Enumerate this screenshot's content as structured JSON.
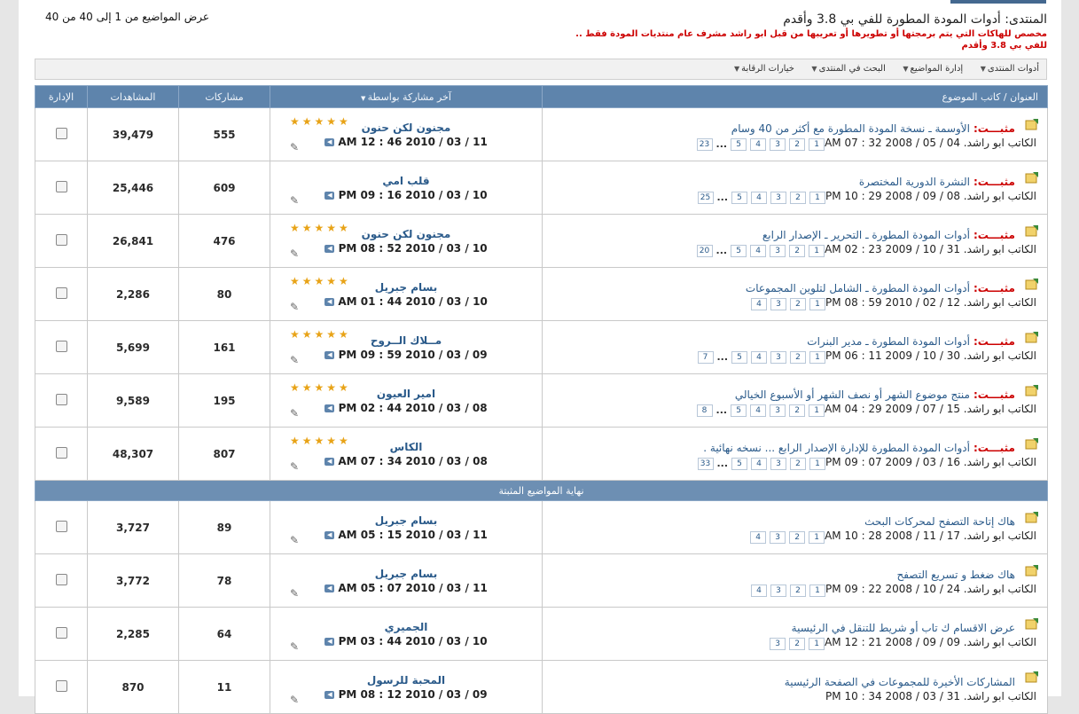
{
  "header": {
    "forum_title": "المنتدى: أدوات المودة المطورة للفي بي 3.8 وأقدم",
    "forum_desc_1": "مخصص للهاكات التي يتم برمجتها أو تطويرها أو تعريبها من قبل ابو راشد مشرف عام منتديات المودة فقط ..",
    "forum_desc_2": "للفي بي 3.8 وأقدم",
    "showing": "عرض المواضيع من 1 إلى 40 من 40"
  },
  "toolbar": {
    "items": [
      "أدوات المنتدى",
      "إدارة المواضيع",
      "البحث في المنتدى",
      "خيارات الرقابة"
    ]
  },
  "columns": {
    "title": "العنوان / كاتب الموضوع",
    "last_post": "آخر مشاركة بواسطة",
    "replies": "مشاركات",
    "views": "المشاهدات",
    "mod": "الإدارة"
  },
  "sticky_separator": "نهاية المواضيع المثبتة",
  "sticky_prefix": "مثبـــت:",
  "threads": [
    {
      "title": "الأوسمة ـ نسخة المودة المطورة مع أكثر من 40 وسام",
      "prefix": true,
      "meta": "الكاتب ابو راشد. 04 / 05 / 2008 32 : 07 AM",
      "pages": [
        "1",
        "2",
        "3",
        "4",
        "5",
        "...",
        "23"
      ],
      "stars": true,
      "last_user": "مجنون لكن حنون",
      "last_date": "11 / 03 / 2010 46 : 12 AM",
      "replies": "555",
      "views": "39,479"
    },
    {
      "title": "النشرة الدورية المختصرة",
      "prefix": true,
      "meta": "الكاتب ابو راشد. 08 / 09 / 2008 29 : 10 PM",
      "pages": [
        "1",
        "2",
        "3",
        "4",
        "5",
        "...",
        "25"
      ],
      "stars": false,
      "last_user": "قلب امي",
      "last_date": "10 / 03 / 2010 16 : 09 PM",
      "replies": "609",
      "views": "25,446"
    },
    {
      "title": "أدوات المودة المطورة ـ التحرير ـ الإصدار الرابع",
      "prefix": true,
      "meta": "الكاتب ابو راشد. 31 / 10 / 2009 23 : 02 AM",
      "pages": [
        "1",
        "2",
        "3",
        "4",
        "5",
        "...",
        "20"
      ],
      "stars": true,
      "last_user": "مجنون لكن حنون",
      "last_date": "10 / 03 / 2010 52 : 08 PM",
      "replies": "476",
      "views": "26,841"
    },
    {
      "title": "أدوات المودة المطورة ـ الشامل لتلوين المجموعات",
      "prefix": true,
      "meta": "الكاتب ابو راشد. 12 / 02 / 2010 59 : 08 PM",
      "pages": [
        "1",
        "2",
        "3",
        "4"
      ],
      "stars": true,
      "last_user": "بسام جبريل",
      "last_date": "10 / 03 / 2010 44 : 01 AM",
      "replies": "80",
      "views": "2,286"
    },
    {
      "title": "أدوات المودة المطورة ـ مدير البنرات",
      "prefix": true,
      "meta": "الكاتب ابو راشد. 30 / 10 / 2009 11 : 06 PM",
      "pages": [
        "1",
        "2",
        "3",
        "4",
        "5",
        "...",
        "7"
      ],
      "stars": true,
      "last_user": "مــلاك الــروح",
      "last_date": "09 / 03 / 2010 59 : 09 PM",
      "replies": "161",
      "views": "5,699"
    },
    {
      "title": "منتج موضوع الشهر أو نصف الشهر أو الأسبوع الخيالي",
      "prefix": true,
      "meta": "الكاتب ابو راشد. 15 / 07 / 2009 29 : 04 AM",
      "pages": [
        "1",
        "2",
        "3",
        "4",
        "5",
        "...",
        "8"
      ],
      "stars": true,
      "last_user": "امير العيون",
      "last_date": "08 / 03 / 2010 44 : 02 PM",
      "replies": "195",
      "views": "9,589"
    },
    {
      "title": "أدوات المودة المطورة للإدارة الإصدار الرابع ... نسخه نهائية .",
      "prefix": true,
      "meta": "الكاتب ابو راشد. 16 / 03 / 2009 07 : 09 PM",
      "pages": [
        "1",
        "2",
        "3",
        "4",
        "5",
        "...",
        "33"
      ],
      "stars": true,
      "last_user": "الكاس",
      "last_date": "08 / 03 / 2010 34 : 07 AM",
      "replies": "807",
      "views": "48,307"
    },
    {
      "title": "هاك إتاحة التصفح لمحركات البحث",
      "prefix": false,
      "meta": "الكاتب ابو راشد. 17 / 11 / 2008 28 : 10 AM",
      "pages": [
        "1",
        "2",
        "3",
        "4"
      ],
      "stars": false,
      "last_user": "بسام جبريل",
      "last_date": "11 / 03 / 2010 15 : 05 AM",
      "replies": "89",
      "views": "3,727"
    },
    {
      "title": "هاك ضغط و تسريع التصفح",
      "prefix": false,
      "meta": "الكاتب ابو راشد. 24 / 10 / 2008 22 : 09 PM",
      "pages": [
        "1",
        "2",
        "3",
        "4"
      ],
      "stars": false,
      "last_user": "بسام جبريل",
      "last_date": "11 / 03 / 2010 07 : 05 AM",
      "replies": "78",
      "views": "3,772"
    },
    {
      "title": "عرض الاقسام ك تاب أو شريط للتنقل في الرئيسية",
      "prefix": false,
      "meta": "الكاتب ابو راشد. 09 / 09 / 2008 21 : 12 AM",
      "pages": [
        "1",
        "2",
        "3"
      ],
      "stars": false,
      "last_user": "الجميري",
      "last_date": "10 / 03 / 2010 44 : 03 PM",
      "replies": "64",
      "views": "2,285"
    },
    {
      "title": "المشاركات الأخيرة للمجموعات في الصفحة الرئيسية",
      "prefix": false,
      "meta": "الكاتب ابو راشد. 31 / 03 / 2008 34 : 10 PM",
      "pages": [],
      "stars": false,
      "last_user": "المحبة للرسول",
      "last_date": "09 / 03 / 2010 12 : 08 PM",
      "replies": "11",
      "views": "870"
    }
  ]
}
